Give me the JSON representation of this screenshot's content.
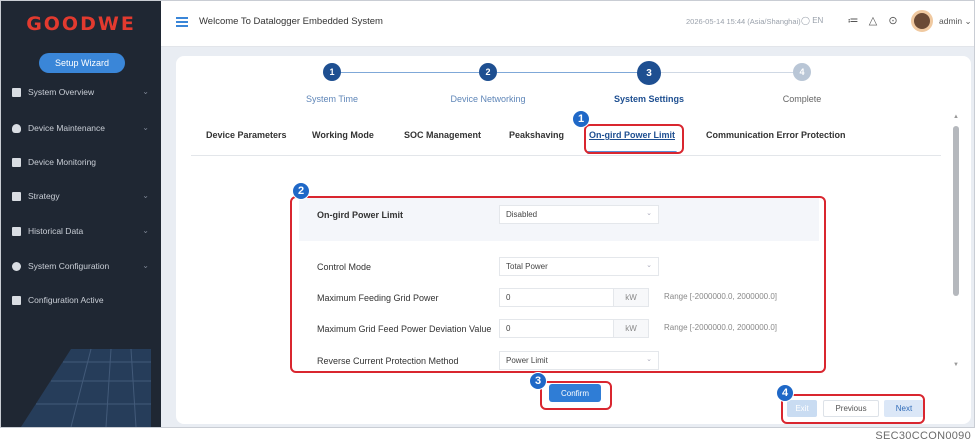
{
  "sidebar": {
    "logo": "GOODWE",
    "setup_wizard": "Setup Wizard",
    "items": [
      {
        "label": "System Overview",
        "icon": "gauge-icon",
        "has_children": true
      },
      {
        "label": "Device Maintenance",
        "icon": "shield-icon",
        "has_children": true
      },
      {
        "label": "Device Monitoring",
        "icon": "monitor-icon",
        "has_children": false
      },
      {
        "label": "Strategy",
        "icon": "strategy-icon",
        "has_children": true
      },
      {
        "label": "Historical Data",
        "icon": "history-icon",
        "has_children": true
      },
      {
        "label": "System Configuration",
        "icon": "gear-icon",
        "has_children": true
      },
      {
        "label": "Configuration Active",
        "icon": "config-icon",
        "has_children": false
      }
    ]
  },
  "topbar": {
    "welcome": "Welcome To Datalogger Embedded System",
    "datetime": "2026-05-14 15:44 (Asia/Shanghai)",
    "language": "EN",
    "user": "admin"
  },
  "steps": [
    {
      "number": "1",
      "label": "System Time",
      "state": "done"
    },
    {
      "number": "2",
      "label": "Device Networking",
      "state": "done"
    },
    {
      "number": "3",
      "label": "System Settings",
      "state": "active"
    },
    {
      "number": "4",
      "label": "Complete",
      "state": "todo"
    }
  ],
  "tabs": [
    "Device Parameters",
    "Working Mode",
    "SOC Management",
    "Peakshaving",
    "On-gird Power Limit",
    "Communication Error Protection"
  ],
  "active_tab": "On-gird Power Limit",
  "form": {
    "limit_label": "On-gird Power Limit",
    "limit_value": "Disabled",
    "control_mode_label": "Control Mode",
    "control_mode_value": "Total Power",
    "max_feed_label": "Maximum Feeding Grid Power",
    "max_feed_value": "0",
    "max_feed_unit": "kW",
    "max_feed_range": "Range [-2000000.0, 2000000.0]",
    "max_dev_label": "Maximum Grid Feed Power Deviation Value",
    "max_dev_value": "0",
    "max_dev_unit": "kW",
    "max_dev_range": "Range [-2000000.0, 2000000.0]",
    "reverse_label": "Reverse Current Protection Method",
    "reverse_value": "Power Limit"
  },
  "buttons": {
    "confirm": "Confirm",
    "exit": "Exit",
    "previous": "Previous",
    "next": "Next"
  },
  "callouts": [
    "1",
    "2",
    "3",
    "4"
  ],
  "figure_code": "SEC30CCON0090",
  "colors": {
    "sidebar_bg": "#1f2733",
    "brand_red": "#e23a2f",
    "accent_blue": "#1e4f91",
    "highlight_red": "#d9262f",
    "callout_blue": "#1f68c7"
  }
}
